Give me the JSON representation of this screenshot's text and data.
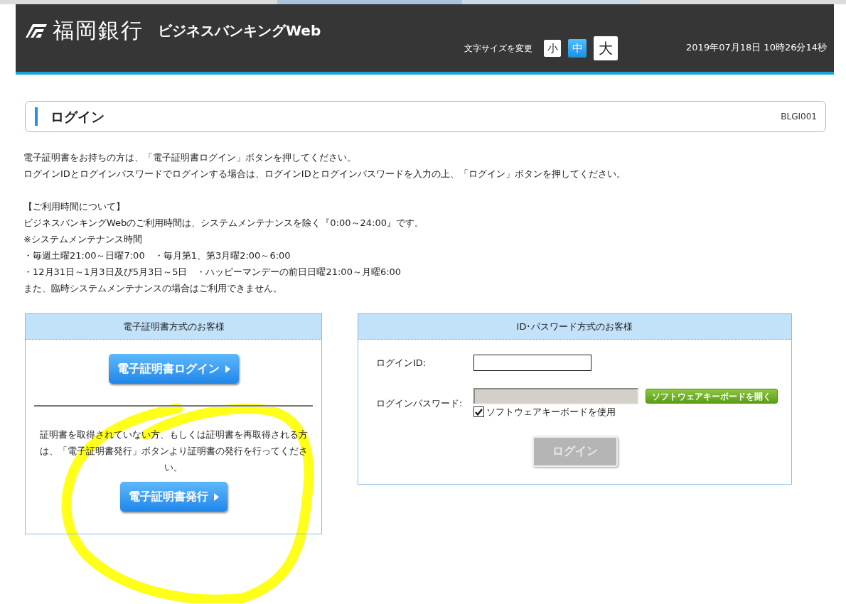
{
  "header": {
    "bank_name": "福岡銀行",
    "service_name": "ビジネスバンキングWeb",
    "font_size_label": "文字サイズを変更",
    "font_sizes": [
      {
        "label": "小",
        "kind": "small",
        "selected": false
      },
      {
        "label": "中",
        "kind": "medium",
        "selected": true
      },
      {
        "label": "大",
        "kind": "large",
        "selected": false
      }
    ],
    "datetime": "2019年07月18日 10時26分14秒"
  },
  "page_title": {
    "title": "ログイン",
    "screen_id": "BLGI001"
  },
  "intro": [
    "電子証明書をお持ちの方は、「電子証明書ログイン」ボタンを押してください。",
    "ログインIDとログインパスワードでログインする場合は、ログインIDとログインパスワードを入力の上、「ログイン」ボタンを押してください。"
  ],
  "hours": [
    "【ご利用時間について】",
    "ビジネスバンキングWebのご利用時間は、システムメンテナンスを除く『0:00～24:00』です。",
    "※システムメンテナンス時間",
    "・毎週土曜21:00～日曜7:00　・毎月第1、第3月曜2:00～6:00",
    "・12月31日～1月3日及び5月3日～5日　・ハッピーマンデーの前日日曜21:00～月曜6:00",
    "また、臨時システムメンテナンスの場合はご利用できません。"
  ],
  "certificate_panel": {
    "title": "電子証明書方式のお客様",
    "login_button": "電子証明書ログイン",
    "note": "証明書を取得されていない方、もしくは証明書を再取得される方は、「電子証明書発行」ボタンより証明書の発行を行ってください。",
    "issue_button": "電子証明書発行"
  },
  "password_panel": {
    "title": "ID･パスワード方式のお客様",
    "id_label": "ログインID:",
    "password_label": "ログインパスワード:",
    "password_disabled": true,
    "keyboard_button": "ソフトウェアキーボードを開く",
    "keyboard_checkbox": {
      "label": "ソフトウェアキーボードを使用",
      "checked": true
    },
    "login_button": {
      "label": "ログイン",
      "disabled": true
    }
  }
}
